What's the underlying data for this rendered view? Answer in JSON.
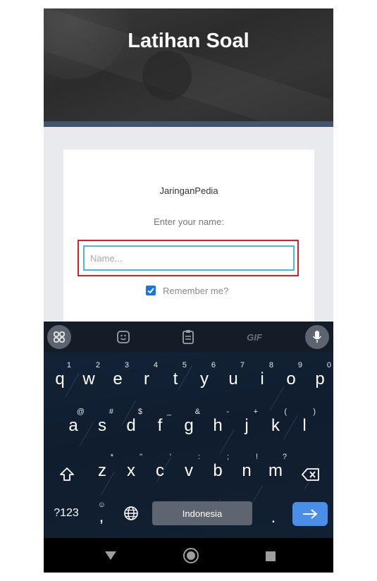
{
  "header": {
    "title": "Latihan Soal"
  },
  "card": {
    "brand": "JaringanPedia",
    "prompt": "Enter your name:",
    "name_input": {
      "value": "",
      "placeholder": "Name..."
    },
    "remember": {
      "label": "Remember me?",
      "checked": true
    }
  },
  "keyboard": {
    "toolbar": [
      "apps-grid-icon",
      "sticker-icon",
      "clipboard-icon",
      "gif-icon",
      "mic-icon"
    ],
    "gif_label": "GIF",
    "row1": [
      {
        "k": "q",
        "h": "1"
      },
      {
        "k": "w",
        "h": "2"
      },
      {
        "k": "e",
        "h": "3"
      },
      {
        "k": "r",
        "h": "4"
      },
      {
        "k": "t",
        "h": "5"
      },
      {
        "k": "y",
        "h": "6"
      },
      {
        "k": "u",
        "h": "7"
      },
      {
        "k": "i",
        "h": "8"
      },
      {
        "k": "o",
        "h": "9"
      },
      {
        "k": "p",
        "h": "0"
      }
    ],
    "row2": [
      {
        "k": "a",
        "h": "@"
      },
      {
        "k": "s",
        "h": "#"
      },
      {
        "k": "d",
        "h": "$"
      },
      {
        "k": "f",
        "h": "_"
      },
      {
        "k": "g",
        "h": "&"
      },
      {
        "k": "h",
        "h": "-"
      },
      {
        "k": "j",
        "h": "+"
      },
      {
        "k": "k",
        "h": "("
      },
      {
        "k": "l",
        "h": ")"
      }
    ],
    "row3": [
      {
        "k": "z",
        "h": "*"
      },
      {
        "k": "x",
        "h": "\""
      },
      {
        "k": "c",
        "h": "'"
      },
      {
        "k": "v",
        "h": ":"
      },
      {
        "k": "b",
        "h": ";"
      },
      {
        "k": "n",
        "h": "!"
      },
      {
        "k": "m",
        "h": "?"
      }
    ],
    "symbols_label": "?123",
    "comma_key": ",",
    "space_label": "Indonesia",
    "period_key": ".",
    "accent_color": "#4a8fe7"
  }
}
